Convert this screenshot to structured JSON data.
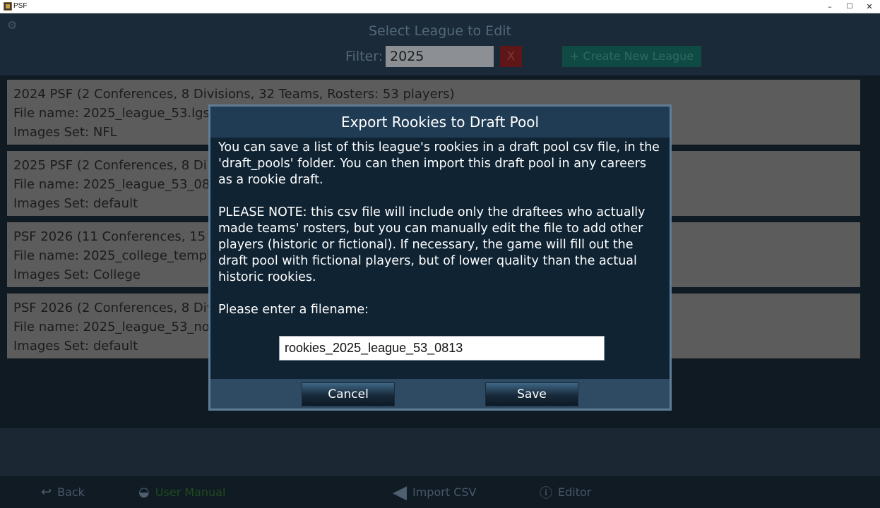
{
  "window": {
    "title": "PSF",
    "minimize": "–",
    "maximize": "☐",
    "close": "✕"
  },
  "header": {
    "title": "Select League to Edit",
    "filter_label": "Filter:",
    "filter_value": "2025",
    "clear_label": "X",
    "create_label": "+ Create New League"
  },
  "leagues": [
    {
      "line1": "2024 PSF (2 Conferences, 8 Divisions, 32 Teams, Rosters: 53 players)",
      "line2": "File name: 2025_league_53.lgs",
      "line3": "Images Set: NFL"
    },
    {
      "line1": "2025 PSF (2 Conferences, 8 Di",
      "line2": "File name: 2025_league_53_08",
      "line3": "Images Set: default"
    },
    {
      "line1": "PSF 2026 (11 Conferences, 15",
      "line2": "File name: 2025_college_templ",
      "line3": "Images Set: College"
    },
    {
      "line1": "PSF 2026 (2 Conferences, 8 Div",
      "line2": "File name: 2025_league_53_no",
      "line3": "Images Set: default"
    }
  ],
  "bottom_nav": {
    "back": "Back",
    "manual": "User Manual",
    "import": "Import CSV",
    "editor": "Editor"
  },
  "modal": {
    "title": "Export Rookies to Draft Pool",
    "paragraph1": "You can save a list of this league's rookies in a draft pool csv file, in the 'draft_pools' folder.  You can then import this draft pool in any careers as a rookie draft.",
    "paragraph2": "PLEASE NOTE: this csv file will include only the draftees who actually made teams' rosters, but you can manually edit the file to add other players (historic or fictional).  If necessary, the game will fill out the draft pool with fictional players, but of lower quality than the actual historic rookies.",
    "prompt": "Please enter a filename:",
    "filename_value": "rookies_2025_league_53_0813",
    "cancel_label": "Cancel",
    "save_label": "Save"
  },
  "icons": {
    "settings": "gear-icon",
    "back": "back-arrow-icon",
    "manual": "hat-icon",
    "import": "left-arrow-icon",
    "editor": "info-icon"
  }
}
